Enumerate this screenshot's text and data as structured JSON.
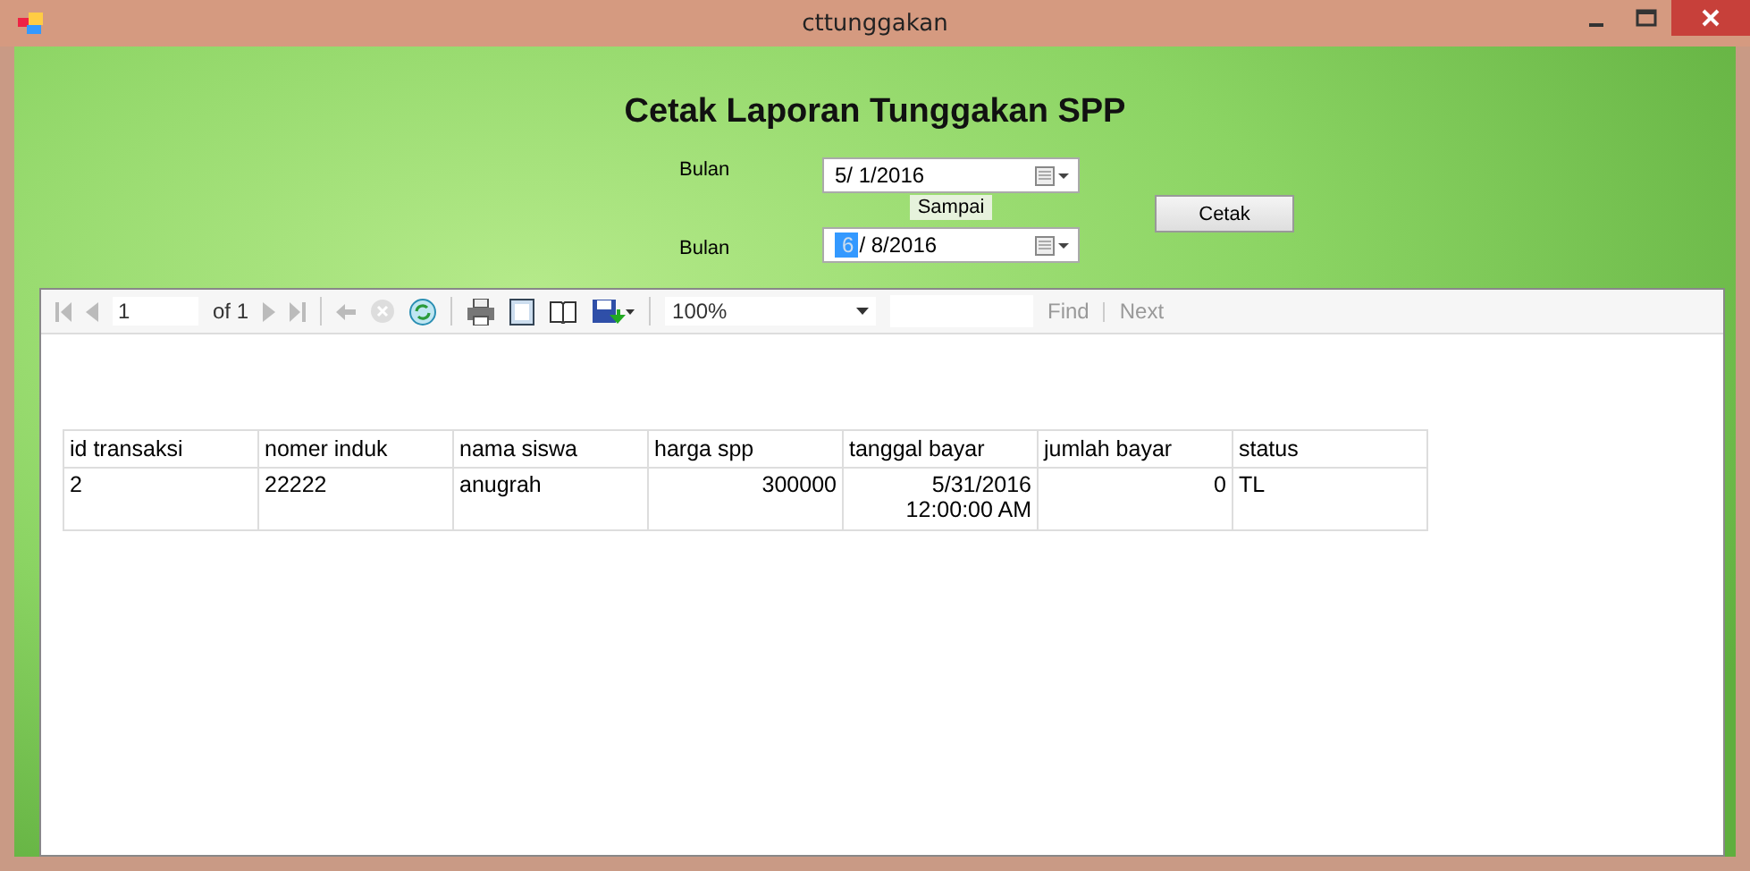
{
  "window": {
    "title": "cttunggakan"
  },
  "heading": "Cetak Laporan Tunggakan SPP",
  "date_from": {
    "label": "Bulan",
    "value": "5/ 1/2016"
  },
  "sampai": "Sampai",
  "date_to": {
    "label": "Bulan",
    "selected_text": "6",
    "value": "/ 8/2016"
  },
  "print_button": "Cetak",
  "report_toolbar": {
    "page": "1",
    "of": "of 1",
    "zoom": "100%",
    "find": "Find",
    "next": "Next"
  },
  "table": {
    "columns": [
      {
        "label": "id transaksi",
        "kind": "text"
      },
      {
        "label": "nomer induk",
        "kind": "text"
      },
      {
        "label": "nama siswa",
        "kind": "text"
      },
      {
        "label": "harga spp",
        "kind": "number"
      },
      {
        "label": "tanggal bayar",
        "kind": "number"
      },
      {
        "label": "jumlah bayar",
        "kind": "number"
      },
      {
        "label": "status",
        "kind": "text"
      }
    ],
    "rows": [
      [
        [
          "2"
        ],
        [
          "22222"
        ],
        [
          "anugrah"
        ],
        [
          "300000"
        ],
        [
          "5/31/2016",
          "12:00:00 AM"
        ],
        [
          "0"
        ],
        [
          "TL"
        ]
      ]
    ]
  }
}
